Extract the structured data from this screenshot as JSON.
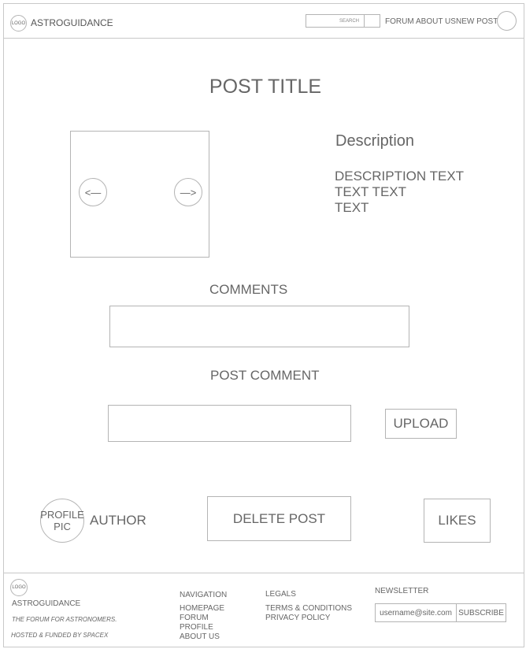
{
  "header": {
    "logo_text": "LOGO",
    "brand": "ASTROGUIDANCE",
    "search_placeholder": "SEARCH",
    "nav": {
      "forum": "FORUM",
      "about": "ABOUT US",
      "new_post": "NEW POST"
    }
  },
  "post": {
    "title": "POST TITLE",
    "carousel": {
      "prev": "<—",
      "next": "—>"
    },
    "description_heading": "Description",
    "description_lines": [
      "DESCRIPTION TEXT",
      "TEXT TEXT",
      "TEXT"
    ],
    "comments_heading": "COMMENTS",
    "post_comment_heading": "POST COMMENT",
    "upload_label": "UPLOAD"
  },
  "author": {
    "pic_lines": [
      "PROFILE",
      "PIC"
    ],
    "name": "AUTHOR"
  },
  "actions": {
    "delete_post": "DELETE POST",
    "likes": "LIKES"
  },
  "footer": {
    "logo_text": "LOGO",
    "brand": "ASTROGUIDANCE",
    "tagline": "THE FORUM FOR ASTRONOMERS.",
    "hosted": "HOSTED & FUNDED BY SPACEX",
    "navigation": {
      "heading": "NAVIGATION",
      "links": [
        "HOMEPAGE",
        "FORUM",
        "PROFILE",
        "ABOUT US"
      ]
    },
    "legals": {
      "heading": "LEGALS",
      "links": [
        "TERMS & CONDITIONS",
        "PRIVACY POLICY"
      ]
    },
    "newsletter": {
      "heading": "NEWSLETTER",
      "email_value": "username@site.com",
      "subscribe": "SUBSCRIBE"
    }
  }
}
